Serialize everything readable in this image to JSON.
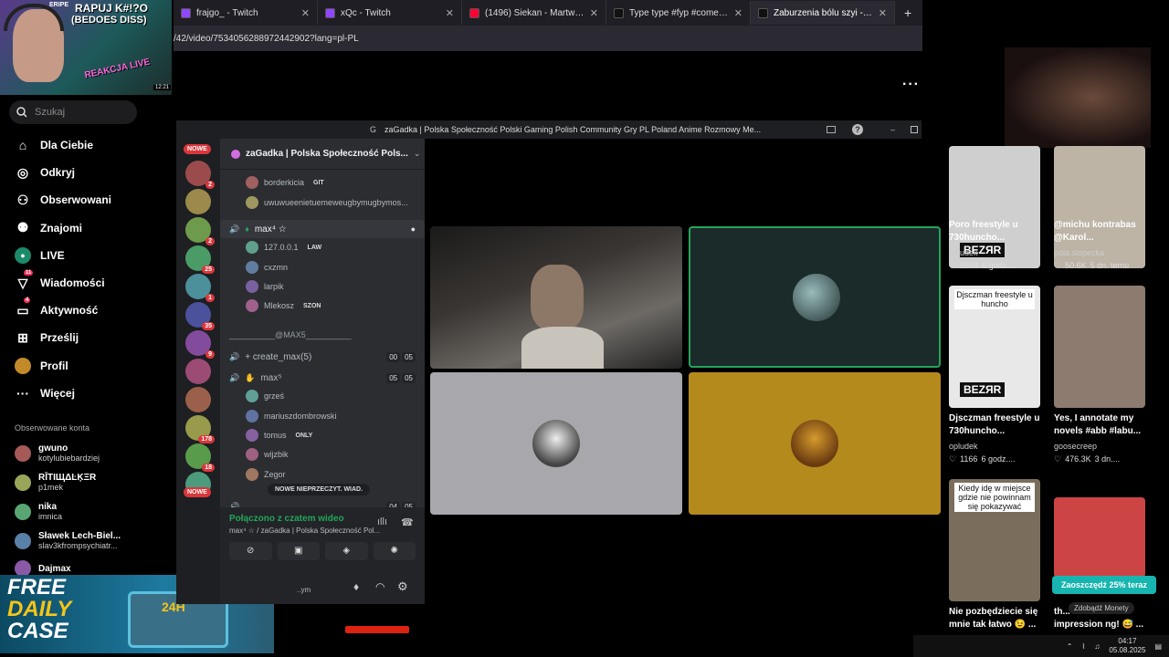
{
  "tabs": [
    {
      "title": "frajgo_ - Twitch",
      "color": "#9146ff"
    },
    {
      "title": "xQc - Twitch",
      "color": "#9146ff"
    },
    {
      "title": "(1496) Siekan - Martwi Kolezdy",
      "color": "#ff0033"
    },
    {
      "title": "Type type #fyp #comedy #foryo",
      "color": "#111"
    },
    {
      "title": "Zaburzenia bólu szyi - objawy i",
      "color": "#111"
    }
  ],
  "new_tab": "+",
  "url": "/42/video/7534056288972442902?lang=pl-PL",
  "stream_overlay": {
    "line1": "RAPUJ K#!?O",
    "line2": "(BEDOES DISS)",
    "brand": "ERIPE",
    "corner": "REAKCJA LIVE",
    "time": "12:21"
  },
  "search_placeholder": "Szukaj",
  "nav": [
    {
      "label": "Dla Ciebie",
      "icon": "home-icon",
      "glyph": "⌂"
    },
    {
      "label": "Odkryj",
      "icon": "compass-icon",
      "glyph": "◎"
    },
    {
      "label": "Obserwowani",
      "icon": "following-icon",
      "glyph": "⚇"
    },
    {
      "label": "Znajomi",
      "icon": "friends-icon",
      "glyph": "⚉"
    },
    {
      "label": "LIVE",
      "icon": "live-icon",
      "glyph": "●"
    },
    {
      "label": "Wiadomości",
      "icon": "messages-icon",
      "glyph": "▽",
      "badge": "11"
    },
    {
      "label": "Aktywność",
      "icon": "activity-icon",
      "glyph": "▭",
      "badge": "4"
    },
    {
      "label": "Prześlij",
      "icon": "upload-icon",
      "glyph": "⊞"
    },
    {
      "label": "Profil",
      "icon": "profile-icon",
      "glyph": "●"
    },
    {
      "label": "Więcej",
      "icon": "more-icon",
      "glyph": "···"
    }
  ],
  "followed_header": "Obserwowane konta",
  "followed": [
    {
      "name": "gwuno",
      "handle": "kotylubiebardziej"
    },
    {
      "name": "RĪTIЩΔĿĶΞR",
      "handle": "p1mek"
    },
    {
      "name": "nika",
      "handle": "imnica"
    },
    {
      "name": "Sławek Lech-Biel...",
      "handle": "slav3kfrompsychiatr..."
    },
    {
      "name": "Dajmax",
      "handle": ""
    }
  ],
  "ad": {
    "line1": "FREE",
    "line2": "DAILY",
    "line3": "CASE",
    "label": "24H"
  },
  "discord": {
    "window_title": "zaGadka | Polska Społeczność Polski Gaming Polish Community Gry PL Poland Anime Rozmowy Me...",
    "server_name": "zaGadka | Polska Społeczność Pols...",
    "new_label": "NOWE",
    "server_badges": [
      "2",
      "",
      "2",
      "25",
      "1",
      "35",
      "9",
      "",
      "",
      "178",
      "18",
      ""
    ],
    "rows": [
      {
        "text": "borderkicia",
        "tag": "GIT",
        "type": "user"
      },
      {
        "text": "uwuwueenietuemeweugbymugbymos...",
        "tag": "",
        "type": "user"
      },
      {
        "text": "max⁴ ☆",
        "tag": "",
        "type": "channel"
      },
      {
        "text": "127.0.0.1",
        "tag": "LAW",
        "type": "user"
      },
      {
        "text": "cxzmn",
        "tag": "",
        "type": "user"
      },
      {
        "text": "larpik",
        "tag": "",
        "type": "user"
      },
      {
        "text": "Mlekosz",
        "tag": "SZON",
        "type": "user"
      },
      {
        "text": "__________@MAX5__________",
        "tag": "",
        "type": "category"
      },
      {
        "text": "+ create_max(5)",
        "tag": "",
        "type": "channel",
        "c1": "00",
        "c2": "05"
      },
      {
        "text": "max⁵",
        "tag": "",
        "type": "channel",
        "c1": "05",
        "c2": "05"
      },
      {
        "text": "grześ",
        "tag": "",
        "type": "user"
      },
      {
        "text": "mariuszdombrowski",
        "tag": "",
        "type": "user"
      },
      {
        "text": "tomus",
        "tag": "ONLY",
        "type": "user"
      },
      {
        "text": "wijzbik",
        "tag": "",
        "type": "user"
      },
      {
        "text": "Zegor",
        "tag": "",
        "type": "user"
      }
    ],
    "last_row": {
      "c1": "04",
      "c2": "05"
    },
    "unread_pill": "NOWE NIEPRZECZYT. WIAD.",
    "connected": "Połączono z czatem wideo",
    "connected_sub": "max⁴ ☆ / zaGadka | Polska Społeczność Pol...",
    "user_status": "..ym"
  },
  "tiktok_videos": [
    {
      "caption1": "Poro freestyle u",
      "caption2": "730huncho...",
      "author": "opludek",
      "likes": "5554",
      "time": "6 godz....",
      "thumb": "BEZЯR",
      "bg": "#cfcfcf"
    },
    {
      "caption1": "@michu kontrabas",
      "caption2": "@Karol...",
      "author": "pola.slopecka",
      "likes": "50.6K",
      "time": "5 dn. temu",
      "thumb": "",
      "bg": "#bdb4a6"
    },
    {
      "caption1": "Djsczman freestyle u",
      "caption2": "730huncho...",
      "author": "opludek",
      "likes": "1166",
      "time": "6 godz....",
      "thumb": "BEZЯR",
      "overlay": "Djsczman freestyle u huncho",
      "bg": "#e8e8e8"
    },
    {
      "caption1": "Yes, I annotate my",
      "caption2": "novels #abb #labu...",
      "author": "goosecreep",
      "likes": "476.3K",
      "time": "3 dn....",
      "thumb": "",
      "bg": "#8c7b6e"
    },
    {
      "caption1": "Nie pozbędziecie się",
      "caption2": "mnie tak łatwo 😉 ...",
      "author": "",
      "likes": "",
      "time": "",
      "thumb": "",
      "overlay": "Kiedy idę w miejsce gdzie nie powinnam się pokazywać",
      "bg": "#7a6d5c"
    },
    {
      "caption1": "th...",
      "caption2": "impression ng! 😅 ...",
      "author": "",
      "likes": "",
      "time": "",
      "thumb": "",
      "bg": "#c44"
    }
  ],
  "promo": "Zaoszczędź 25% teraz",
  "coins": "Zdobądź Monety",
  "clock_time": "04:17",
  "clock_date": "05.08.2025",
  "more_dots": "···"
}
